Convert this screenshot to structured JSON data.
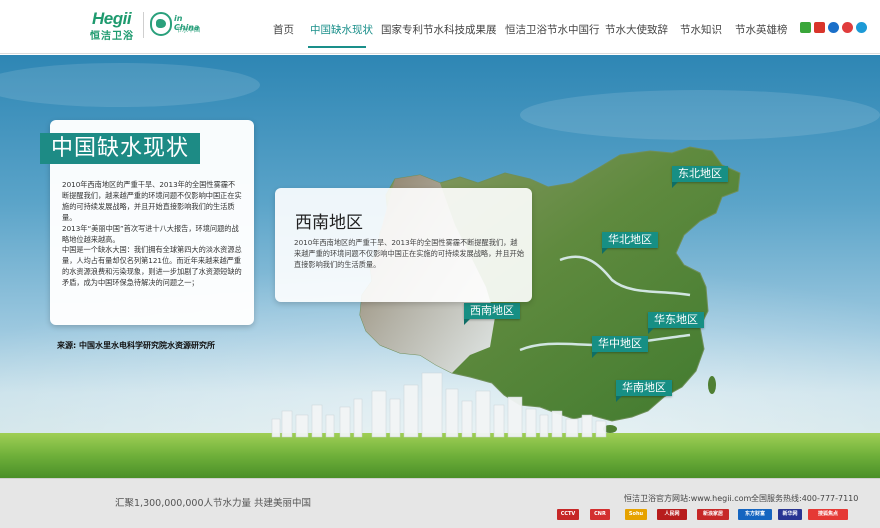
{
  "header": {
    "logo_brand": "Hegii",
    "logo_cn": "恒洁卫浴",
    "partner_logo_en": "in China",
    "partner_logo_cn": "节水中国",
    "nav": [
      {
        "label": "首页"
      },
      {
        "label": "中国缺水现状",
        "active": true
      },
      {
        "label": "国家专利节水科技成果展"
      },
      {
        "label": "恒洁卫浴节水中国行"
      },
      {
        "label": "节水大使致辞"
      },
      {
        "label": "节水知识"
      },
      {
        "label": "节水英雄榜"
      }
    ],
    "social_icons": [
      "qzone-icon",
      "renren-icon",
      "kaixin-icon",
      "weibo-icon",
      "tencent-weibo-icon"
    ]
  },
  "main_panel": {
    "title": "中国缺水现状",
    "paragraphs": [
      "2010年西南地区的严重干旱、2013年的全国性雾霾不断提醒我们，越来越严重的环境问题不仅影响中国正在实施的可持续发展战略，并且开始直接影响我们的生活质量。",
      "2013年“美丽中国”首次写进十八大报告，环境问题的战略地位越来越高。",
      "中国是一个缺水大国：我们拥有全球第四大的淡水资源总量，人均占有量却仅名列第121位。而近年来越来越严重的水资源浪费和污染现象，则进一步加剧了水资源短缺的矛盾，成为中国环保急待解决的问题之一；"
    ],
    "source": "来源:   中国水里水电科学研究院水资源研究所"
  },
  "popup": {
    "title": "西南地区",
    "text": "2010年西南地区的严重干旱、2013年的全国性雾霾不断提醒我们，越来越严重的环境问题不仅影响中国正在实施的可持续发展战略，并且开始直接影响我们的生活质量。"
  },
  "regions": {
    "northeast": "东北地区",
    "north": "华北地区",
    "southwest": "西南地区",
    "east": "华东地区",
    "central": "华中地区",
    "south": "华南地区"
  },
  "footer": {
    "slogan": "汇聚1,300,000,000人节水力量 共建美丽中国",
    "site": "恒洁卫浴官方网站:www.hegii.com",
    "hotline": "全国服务热线:400-777-7110",
    "partners": [
      "CCTV",
      "CNR",
      "Sohu",
      "人民网",
      "新浪家居",
      "东方财富",
      "新华网",
      "搜狐焦点"
    ]
  },
  "colors": {
    "accent": "#1d8b85",
    "region_tag": "#178f84"
  }
}
